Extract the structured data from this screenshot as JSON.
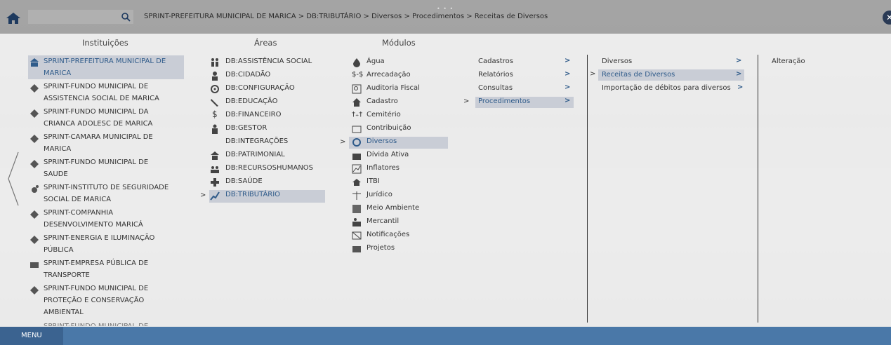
{
  "search": {
    "placeholder": "",
    "value": ""
  },
  "breadcrumb": "SPRINT-PREFEITURA MUNICIPAL DE MARICA > DB:TRIBUTÁRIO > Diversos > Procedimentos > Receitas de Diversos",
  "headers": {
    "instituicoes": "Instituições",
    "areas": "Áreas",
    "modulos": "Módulos"
  },
  "instituicoes": [
    "SPRINT-PREFEITURA MUNICIPAL DE",
    "MARICA",
    "SPRINT-FUNDO MUNICIPAL DE",
    "ASSISTENCIA SOCIAL DE MARICA",
    "SPRINT-FUNDO MUNICIPAL DA",
    "CRIANCA ADOLESC DE MARICA",
    "SPRINT-CAMARA MUNICIPAL DE",
    "MARICA",
    "SPRINT-FUNDO MUNICIPAL DE",
    "SAUDE",
    "SPRINT-INSTITUTO DE SEGURIDADE",
    "SOCIAL DE MARICA",
    "SPRINT-COMPANHIA",
    "DESENVOLVIMENTO MARICÁ",
    "SPRINT-ENERGIA E ILUMINAÇÃO",
    "PÚBLICA",
    "SPRINT-EMPRESA PÚBLICA DE",
    "TRANSPORTE",
    "SPRINT-FUNDO MUNICIPAL DE",
    "PROTEÇÃO E CONSERVAÇÃO",
    "AMBIENTAL",
    "SPRINT-FUNDO MUNICIPAL DE"
  ],
  "areas": [
    "DB:ASSISTÊNCIA SOCIAL",
    "DB:CIDADÃO",
    "DB:CONFIGURAÇÃO",
    "DB:EDUCAÇÃO",
    "DB:FINANCEIRO",
    "DB:GESTOR",
    "DB:INTEGRAÇÕES",
    "DB:PATRIMONIAL",
    "DB:RECURSOSHUMANOS",
    "DB:SAÚDE",
    "DB:TRIBUTÁRIO"
  ],
  "modulos": [
    "Água",
    "Arrecadação",
    "Auditoria Fiscal",
    "Cadastro",
    "Cemitério",
    "Contribuição",
    "Diversos",
    "Dívida Ativa",
    "Inflatores",
    "ITBI",
    "Jurídico",
    "Meio Ambiente",
    "Mercantil",
    "Notificações",
    "Projetos"
  ],
  "menu_col1": [
    "Cadastros",
    "Relatórios",
    "Consultas",
    "Procedimentos"
  ],
  "menu_col2": [
    "Diversos",
    "Receitas de Diversos",
    "Importação de débitos para diversos"
  ],
  "menu_col3": [
    "Alteração"
  ],
  "glyphs": {
    "chevron_right": ">",
    "close": "✕"
  },
  "bottom": {
    "menu_label": "MENU"
  },
  "colors": {
    "selected_text": "#2f5b8a",
    "bottom_bar": "#4a78a8"
  }
}
